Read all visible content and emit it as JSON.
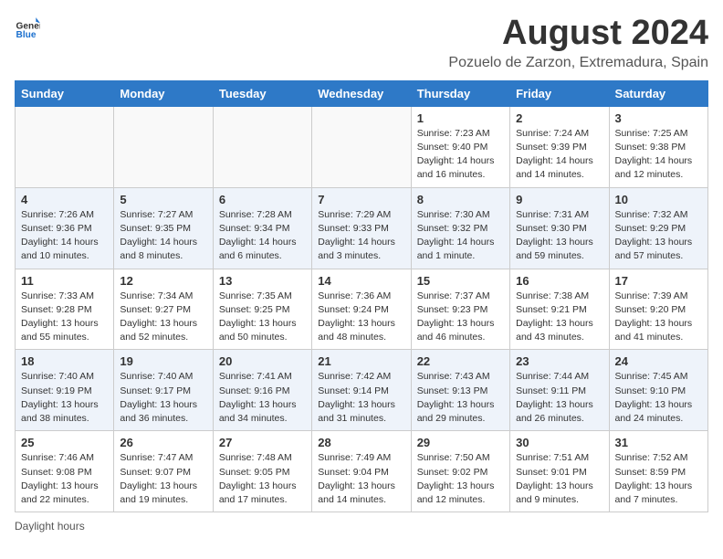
{
  "header": {
    "logo_general": "General",
    "logo_blue": "Blue",
    "main_title": "August 2024",
    "subtitle": "Pozuelo de Zarzon, Extremadura, Spain"
  },
  "columns": [
    "Sunday",
    "Monday",
    "Tuesday",
    "Wednesday",
    "Thursday",
    "Friday",
    "Saturday"
  ],
  "weeks": [
    [
      {
        "day": "",
        "info": ""
      },
      {
        "day": "",
        "info": ""
      },
      {
        "day": "",
        "info": ""
      },
      {
        "day": "",
        "info": ""
      },
      {
        "day": "1",
        "info": "Sunrise: 7:23 AM\nSunset: 9:40 PM\nDaylight: 14 hours and 16 minutes."
      },
      {
        "day": "2",
        "info": "Sunrise: 7:24 AM\nSunset: 9:39 PM\nDaylight: 14 hours and 14 minutes."
      },
      {
        "day": "3",
        "info": "Sunrise: 7:25 AM\nSunset: 9:38 PM\nDaylight: 14 hours and 12 minutes."
      }
    ],
    [
      {
        "day": "4",
        "info": "Sunrise: 7:26 AM\nSunset: 9:36 PM\nDaylight: 14 hours and 10 minutes."
      },
      {
        "day": "5",
        "info": "Sunrise: 7:27 AM\nSunset: 9:35 PM\nDaylight: 14 hours and 8 minutes."
      },
      {
        "day": "6",
        "info": "Sunrise: 7:28 AM\nSunset: 9:34 PM\nDaylight: 14 hours and 6 minutes."
      },
      {
        "day": "7",
        "info": "Sunrise: 7:29 AM\nSunset: 9:33 PM\nDaylight: 14 hours and 3 minutes."
      },
      {
        "day": "8",
        "info": "Sunrise: 7:30 AM\nSunset: 9:32 PM\nDaylight: 14 hours and 1 minute."
      },
      {
        "day": "9",
        "info": "Sunrise: 7:31 AM\nSunset: 9:30 PM\nDaylight: 13 hours and 59 minutes."
      },
      {
        "day": "10",
        "info": "Sunrise: 7:32 AM\nSunset: 9:29 PM\nDaylight: 13 hours and 57 minutes."
      }
    ],
    [
      {
        "day": "11",
        "info": "Sunrise: 7:33 AM\nSunset: 9:28 PM\nDaylight: 13 hours and 55 minutes."
      },
      {
        "day": "12",
        "info": "Sunrise: 7:34 AM\nSunset: 9:27 PM\nDaylight: 13 hours and 52 minutes."
      },
      {
        "day": "13",
        "info": "Sunrise: 7:35 AM\nSunset: 9:25 PM\nDaylight: 13 hours and 50 minutes."
      },
      {
        "day": "14",
        "info": "Sunrise: 7:36 AM\nSunset: 9:24 PM\nDaylight: 13 hours and 48 minutes."
      },
      {
        "day": "15",
        "info": "Sunrise: 7:37 AM\nSunset: 9:23 PM\nDaylight: 13 hours and 46 minutes."
      },
      {
        "day": "16",
        "info": "Sunrise: 7:38 AM\nSunset: 9:21 PM\nDaylight: 13 hours and 43 minutes."
      },
      {
        "day": "17",
        "info": "Sunrise: 7:39 AM\nSunset: 9:20 PM\nDaylight: 13 hours and 41 minutes."
      }
    ],
    [
      {
        "day": "18",
        "info": "Sunrise: 7:40 AM\nSunset: 9:19 PM\nDaylight: 13 hours and 38 minutes."
      },
      {
        "day": "19",
        "info": "Sunrise: 7:40 AM\nSunset: 9:17 PM\nDaylight: 13 hours and 36 minutes."
      },
      {
        "day": "20",
        "info": "Sunrise: 7:41 AM\nSunset: 9:16 PM\nDaylight: 13 hours and 34 minutes."
      },
      {
        "day": "21",
        "info": "Sunrise: 7:42 AM\nSunset: 9:14 PM\nDaylight: 13 hours and 31 minutes."
      },
      {
        "day": "22",
        "info": "Sunrise: 7:43 AM\nSunset: 9:13 PM\nDaylight: 13 hours and 29 minutes."
      },
      {
        "day": "23",
        "info": "Sunrise: 7:44 AM\nSunset: 9:11 PM\nDaylight: 13 hours and 26 minutes."
      },
      {
        "day": "24",
        "info": "Sunrise: 7:45 AM\nSunset: 9:10 PM\nDaylight: 13 hours and 24 minutes."
      }
    ],
    [
      {
        "day": "25",
        "info": "Sunrise: 7:46 AM\nSunset: 9:08 PM\nDaylight: 13 hours and 22 minutes."
      },
      {
        "day": "26",
        "info": "Sunrise: 7:47 AM\nSunset: 9:07 PM\nDaylight: 13 hours and 19 minutes."
      },
      {
        "day": "27",
        "info": "Sunrise: 7:48 AM\nSunset: 9:05 PM\nDaylight: 13 hours and 17 minutes."
      },
      {
        "day": "28",
        "info": "Sunrise: 7:49 AM\nSunset: 9:04 PM\nDaylight: 13 hours and 14 minutes."
      },
      {
        "day": "29",
        "info": "Sunrise: 7:50 AM\nSunset: 9:02 PM\nDaylight: 13 hours and 12 minutes."
      },
      {
        "day": "30",
        "info": "Sunrise: 7:51 AM\nSunset: 9:01 PM\nDaylight: 13 hours and 9 minutes."
      },
      {
        "day": "31",
        "info": "Sunrise: 7:52 AM\nSunset: 8:59 PM\nDaylight: 13 hours and 7 minutes."
      }
    ]
  ],
  "footer": "Daylight hours"
}
